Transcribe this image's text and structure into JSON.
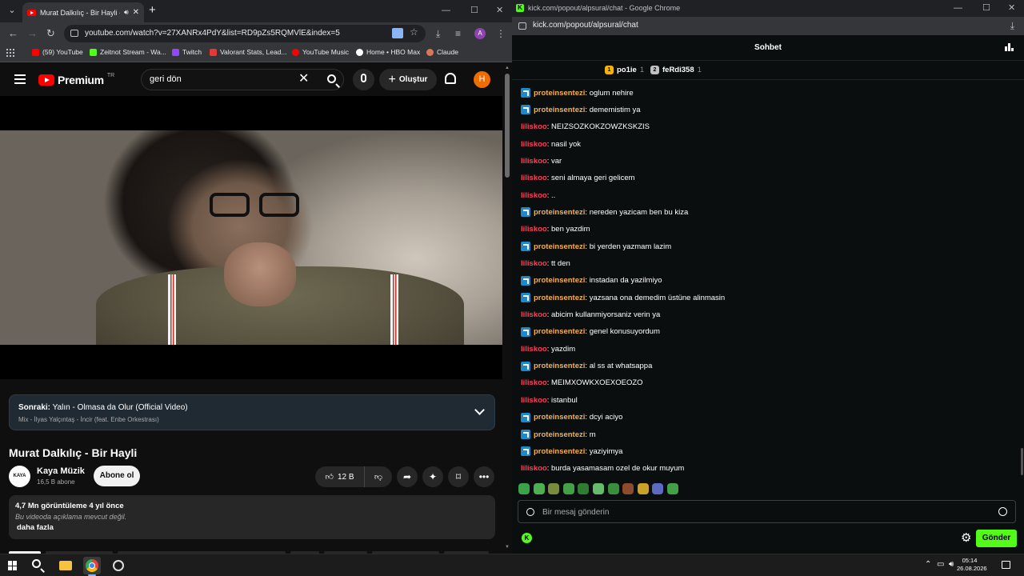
{
  "youtube_window": {
    "tab": {
      "title": "Murat Dalkılıç - Bir Hayli - Y"
    },
    "address_bar": {
      "url": "youtube.com/watch?v=27XANRx4PdY&list=RD9pZs5RQMVlE&index=5"
    },
    "bookmarks": [
      {
        "label": "(59) YouTube",
        "color": "#ff0000"
      },
      {
        "label": "Zeitnot Stream - Wa...",
        "color": "#53fc18"
      },
      {
        "label": "Twitch",
        "color": "#9146ff"
      },
      {
        "label": "Valorant Stats, Lead...",
        "color": "#e53935"
      },
      {
        "label": "YouTube Music",
        "color": "#ff0000"
      },
      {
        "label": "Home • HBO Max",
        "color": "#ffffff"
      },
      {
        "label": "Claude",
        "color": "#d97757"
      }
    ],
    "header": {
      "logo": "Premium",
      "logo_region": "TR",
      "search_value": "geri dön",
      "create_label": "Oluştur",
      "avatar_letter": "H"
    },
    "up_next": {
      "prefix": "Sonraki:",
      "title": "Yalın - Olmasa da Olur (Official Video)",
      "subtitle": "Mix - İlyas Yalçıntaş - İncir (feat. Enbe Orkestrası)"
    },
    "video": {
      "title": "Murat Dalkılıç - Bir Hayli",
      "channel": "Kaya Müzik",
      "channel_logo": "KAYA",
      "subscribers": "16,5 B abone",
      "subscribe_label": "Abone ol",
      "likes": "12 B"
    },
    "description": {
      "stats": "4,7 Mn görüntüleme  4 yıl önce",
      "text": "Bu videoda açıklama mevcut değil.",
      "more": "daha fazla"
    }
  },
  "kick_window": {
    "window_title": "kick.com/popout/alpsural/chat - Google Chrome",
    "url": "kick.com/popout/alpsural/chat",
    "chat_title": "Sohbet",
    "leaderboard": [
      {
        "rank": "1",
        "name": "po1ie",
        "count": "1",
        "color": "#f5b400"
      },
      {
        "rank": "2",
        "name": "feRdi358",
        "count": "1",
        "color": "#c0c0c0"
      }
    ],
    "messages": [
      {
        "user": "proteinsentezi",
        "badge": true,
        "text": "oglum nehire"
      },
      {
        "user": "proteinsentezi",
        "badge": true,
        "text": "dememistim ya"
      },
      {
        "user": "liliskoo",
        "badge": false,
        "text": "NEIZSOZKOKZOWZKSKZIS"
      },
      {
        "user": "liliskoo",
        "badge": false,
        "text": "nasil yok"
      },
      {
        "user": "liliskoo",
        "badge": false,
        "text": "var"
      },
      {
        "user": "liliskoo",
        "badge": false,
        "text": "seni almaya geri gelicem"
      },
      {
        "user": "liliskoo",
        "badge": false,
        "text": ".."
      },
      {
        "user": "proteinsentezi",
        "badge": true,
        "text": "nereden yazicam ben bu kiza"
      },
      {
        "user": "liliskoo",
        "badge": false,
        "text": "ben yazdim"
      },
      {
        "user": "proteinsentezi",
        "badge": true,
        "text": "bi yerden yazmam lazim"
      },
      {
        "user": "liliskoo",
        "badge": false,
        "text": "tt den"
      },
      {
        "user": "proteinsentezi",
        "badge": true,
        "text": "instadan da yazilmiyo"
      },
      {
        "user": "proteinsentezi",
        "badge": true,
        "text": "yazsana ona demedim üstüne alinmasin"
      },
      {
        "user": "liliskoo",
        "badge": false,
        "text": "abicim kullanmiyorsaniz verin ya"
      },
      {
        "user": "proteinsentezi",
        "badge": true,
        "text": "genel konusuyordum"
      },
      {
        "user": "liliskoo",
        "badge": false,
        "text": "yazdim"
      },
      {
        "user": "proteinsentezi",
        "badge": true,
        "text": "al ss at whatsappa"
      },
      {
        "user": "liliskoo",
        "badge": false,
        "text": "MEIMXOWKXOEXOEOZO"
      },
      {
        "user": "liliskoo",
        "badge": false,
        "text": "istanbul"
      },
      {
        "user": "proteinsentezi",
        "badge": true,
        "text": "dcyi aciyo"
      },
      {
        "user": "proteinsentezi",
        "badge": true,
        "text": "m"
      },
      {
        "user": "proteinsentezi",
        "badge": true,
        "text": "yaziyimya"
      },
      {
        "user": "liliskoo",
        "badge": false,
        "text": "burda yasamasam ozel de okur muyum"
      }
    ],
    "user_colors": {
      "proteinsentezi": "#f4b24c",
      "liliskoo": "#ff3d5a"
    },
    "input_placeholder": "Bir mesaj gönderin",
    "send_label": "Gönder",
    "emote_colors": [
      "#3aa34a",
      "#4caf50",
      "#7a8b3c",
      "#43a047",
      "#2e7d32",
      "#66bb6a",
      "#388e3c",
      "#8d4b2e",
      "#c9a227",
      "#5c6bc0",
      "#43a047"
    ]
  },
  "taskbar": {
    "time": "05:14",
    "date": "26.08.2026"
  },
  "colors": {
    "kick_green": "#53fc18",
    "youtube_red": "#ff0000"
  }
}
